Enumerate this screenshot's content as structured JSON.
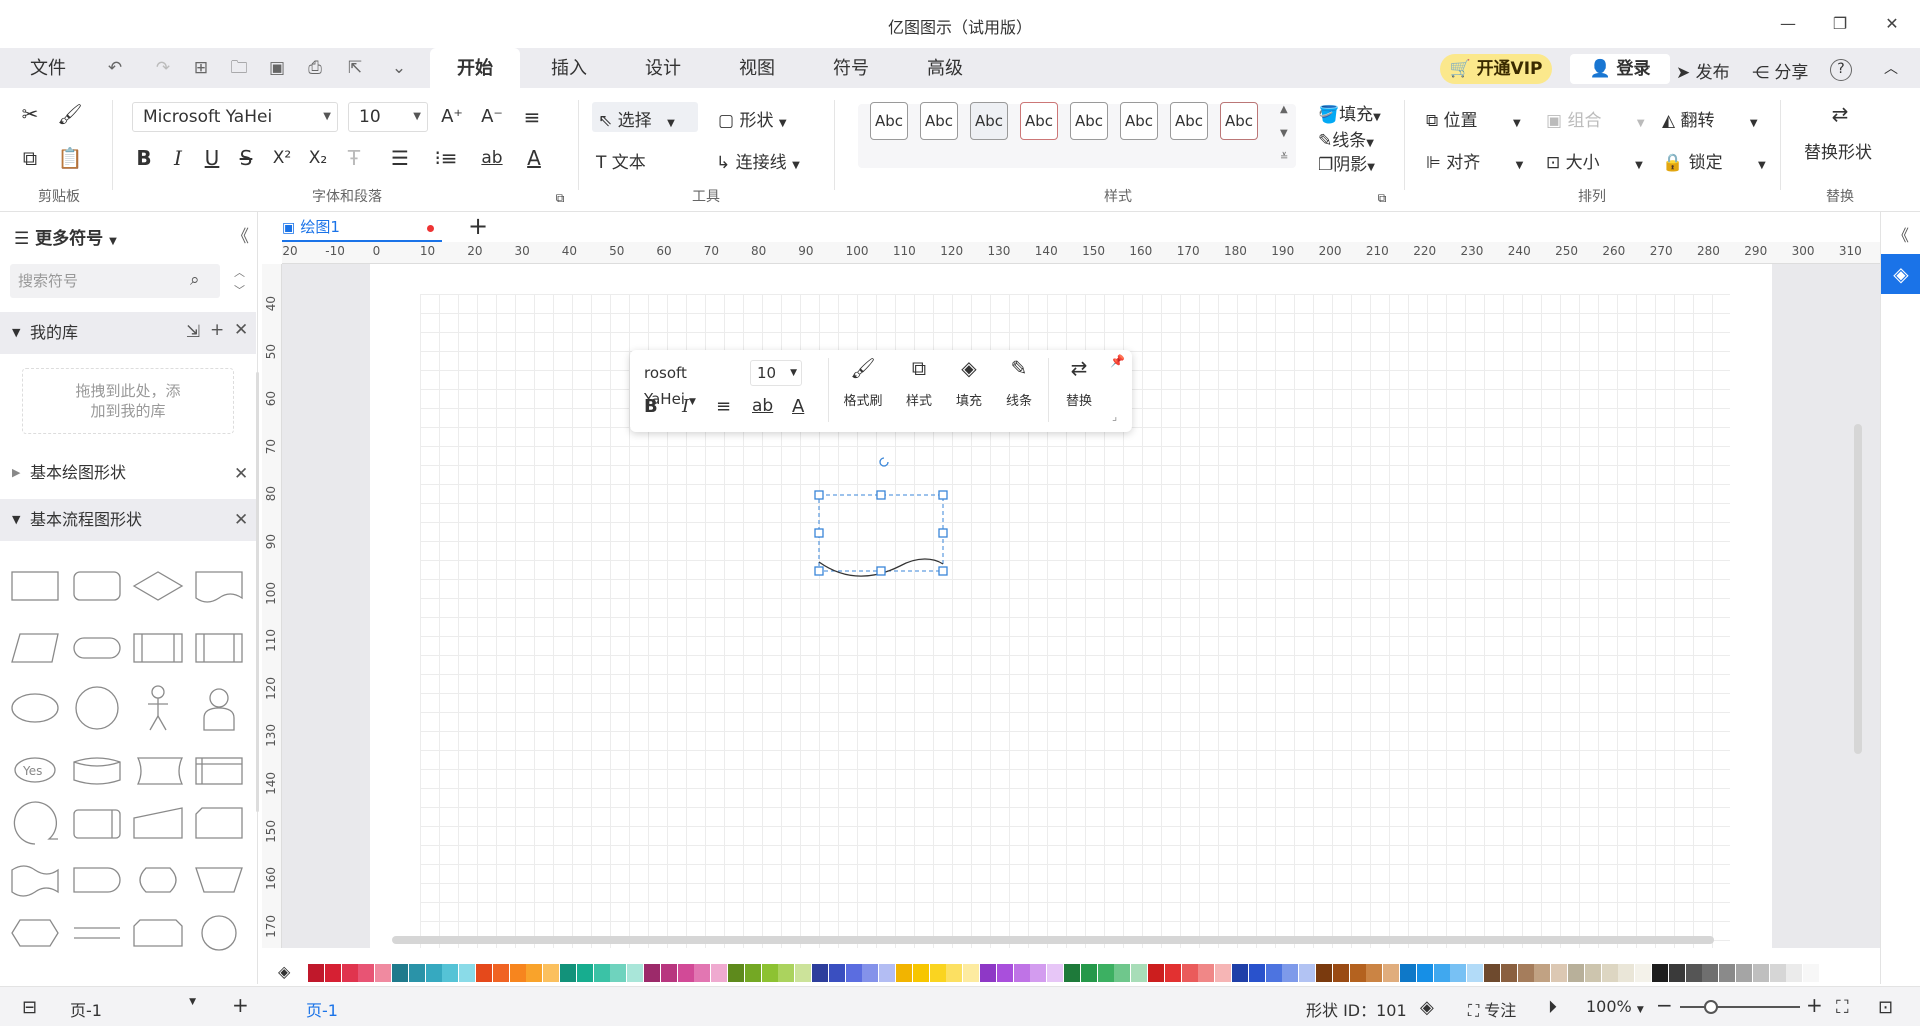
{
  "app": {
    "title": "亿图图示（试用版）"
  },
  "menubar": {
    "file": "文件",
    "tabs": [
      "开始",
      "插入",
      "设计",
      "视图",
      "符号",
      "高级"
    ],
    "vip": "开通VIP",
    "login": "登录",
    "publish": "发布",
    "share": "分享",
    "help": "?"
  },
  "ribbon": {
    "clipboard_label": "剪贴板",
    "font_label": "字体和段落",
    "tools_label": "工具",
    "style_label": "样式",
    "arrange_label": "排列",
    "replace_label": "替换",
    "font_name": "Microsoft YaHei",
    "font_size": "10",
    "select": "选择",
    "shape": "形状",
    "text": "文本",
    "connector": "连接线",
    "style_swatch": "Abc",
    "fill": "填充",
    "line": "线条",
    "shadow": "阴影",
    "position": "位置",
    "group": "组合",
    "flip": "翻转",
    "align": "对齐",
    "size": "大小",
    "lock": "锁定",
    "replace_shape": "替换形状"
  },
  "left_panel": {
    "title": "更多符号",
    "search_placeholder": "搜索符号",
    "my_lib": "我的库",
    "drop_hint_1": "拖拽到此处，添",
    "drop_hint_2": "加到我的库",
    "basic_shapes": "基本绘图形状",
    "flowchart": "基本流程图形状",
    "yes_label": "Yes"
  },
  "doc_tab": {
    "name": "绘图1"
  },
  "ruler": {
    "h_ticks": [
      "-20",
      "-10",
      "0",
      "10",
      "20",
      "30",
      "40",
      "50",
      "60",
      "70",
      "80",
      "90",
      "100",
      "110",
      "120",
      "130",
      "140",
      "150",
      "160",
      "170",
      "180",
      "190",
      "200",
      "210",
      "220",
      "230",
      "240",
      "250",
      "260",
      "270",
      "280",
      "290",
      "300",
      "310"
    ],
    "v_ticks": [
      "40",
      "50",
      "60",
      "70",
      "80",
      "90",
      "100",
      "110",
      "120",
      "130",
      "140",
      "150",
      "160",
      "170"
    ]
  },
  "float_toolbar": {
    "font": "rosoft YaHei",
    "size": "10",
    "format_painter": "格式刷",
    "style": "样式",
    "fill": "填充",
    "line": "线条",
    "replace": "替换"
  },
  "palette": {
    "colors": [
      "#c0182b",
      "#d62033",
      "#e0344e",
      "#e85474",
      "#f08aa0",
      "#1f7a8c",
      "#2a93a8",
      "#36a9c0",
      "#55c3d6",
      "#8adbe8",
      "#e5491b",
      "#f06323",
      "#f7851e",
      "#f9a32b",
      "#fbc05e",
      "#12927a",
      "#17ad8f",
      "#3bc2a6",
      "#6fd3be",
      "#a9e6d9",
      "#9c2a6a",
      "#b8367f",
      "#d24a97",
      "#e276b2",
      "#efaad0",
      "#5e8a1c",
      "#74a824",
      "#8dc232",
      "#abd35e",
      "#cce39a",
      "#2d3e9c",
      "#3a4fc0",
      "#5b6de0",
      "#8492ea",
      "#b3bdf3",
      "#f2b400",
      "#f7c600",
      "#fad420",
      "#fce062",
      "#fdeba0",
      "#8e38c6",
      "#a94fdc",
      "#bf73e6",
      "#d39cef",
      "#e7c6f7",
      "#1e7a3a",
      "#25984a",
      "#3cb062",
      "#6fc78c",
      "#a8ddb8",
      "#cc1e1e",
      "#e23131",
      "#ea5b5b",
      "#f08787",
      "#f6b5b5",
      "#1f3fa8",
      "#2952cc",
      "#4d74e0",
      "#7e9aea",
      "#b2c3f3",
      "#7a3a0e",
      "#9a4b14",
      "#b4621f",
      "#cb8444",
      "#e0ad7d",
      "#0e78c8",
      "#168fe6",
      "#40a8ef",
      "#78c1f4",
      "#b2dbf8",
      "#6e4a2e",
      "#8a6040",
      "#a57d5c",
      "#c1a283",
      "#dcc8b3",
      "#b8b09a",
      "#cdc5ae",
      "#ddd6c2",
      "#eae6d8",
      "#f4f2ea",
      "#1e1e1e",
      "#3a3a3a",
      "#555555",
      "#6f6f6f",
      "#8a8a8a",
      "#a5a5a5",
      "#bfbfbf",
      "#d6d6d6",
      "#ebebeb",
      "#f7f7f7"
    ]
  },
  "status": {
    "page_select": "页-1",
    "page_tab": "页-1",
    "shape_id": "形状 ID：101",
    "focus": "专注",
    "zoom": "100%"
  }
}
